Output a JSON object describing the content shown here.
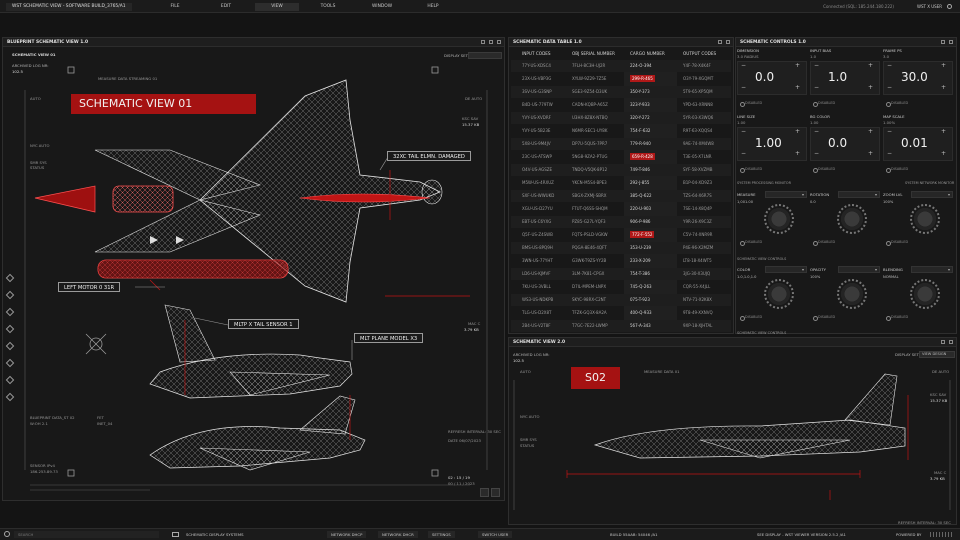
{
  "app": {
    "title": "WST SCHEMATIC VIEW - SOFTWARE BUILD_3765/A1",
    "menu": [
      "FILE",
      "EDIT",
      "VIEW",
      "TOOLS",
      "WINDOW",
      "HELP"
    ],
    "connection": "Connected (SQL: 185.244.180.222)",
    "user": "WST X USER"
  },
  "blueprint": {
    "panel_title": "BLUEPRINT SCHEMATIC VIEW 1.0",
    "subtitle": "SCHEMATIC VIEW 01",
    "archived_label": "ARCHIVED LOG NR:",
    "archived_value": "102.5",
    "display_set": "DISPLAY SET",
    "streaming": "MEASURE DATA STREAMING 01",
    "auto_left": "AUTO",
    "auto_right": "DE AUTO",
    "nyc_auto": "NYC AUTO",
    "smr": "SMR SYS",
    "status": "STATUS",
    "ksc_label": "KSC SAV",
    "ksc_value": "15.37 KB",
    "mac_label": "MAC C",
    "mac_value": "3.79 KB",
    "blueprint_label": "BLUEPRINT DATA_ST 02",
    "blueprint_value": "W:OH 2.1",
    "sensor": "SENSOR IPv4",
    "sensor_ip": "186.253.89.73",
    "fet": "FET",
    "fet_value": "INET_04",
    "refresh": "REFRESH INTERVAL: 30 SEC",
    "date": "DATE 06/07/2023",
    "time": "02 : 15 / 19",
    "time_sub": "00 / 11 / 2023",
    "red_title": "SCHEMATIC VIEW 01",
    "callouts": [
      "32XC TAIL ELMN. DAMAGED",
      "LEFT MOTOR 0 31R",
      "MLTP X TAIL SENSOR 1",
      "MLT PLANE MODEL X3"
    ]
  },
  "table": {
    "panel_title": "SCHEMATIC DATA TABLE 1.0",
    "headers": [
      "INPUT CODES",
      "OBJ SERIAL NUMBER",
      "CARGO NUMBER",
      "OUTPUT CODES"
    ],
    "rows": [
      [
        "77Y-US-XDSC4",
        "7FLH-8C3H-UJ2R",
        "224-O-394",
        "Y4F-78-X4K4F"
      ],
      [
        "23X-US-VBP3G",
        "XYLW-9Z29-7Z5E",
        "299-R-465",
        "O3Y-79-XGQMT"
      ],
      [
        "3SV-US-G3SNP",
        "SGE3-9Z54-D3UK",
        "350-Y-373",
        "5T9-65-XP5QM"
      ],
      [
        "B4D-US-779TW",
        "CADN-KQBP-A65Z",
        "323-Y-933",
        "YPD-63-XRNN8"
      ],
      [
        "YVY-US-XVDRF",
        "U3HX-8Z8X-NTBQ",
        "320-Y-272",
        "5YR-03-X3WQ6"
      ],
      [
        "YVY-US-5B23E",
        "N6MR-SEC1-UY8K",
        "754-F-632",
        "R9T-63-XQQS4"
      ],
      [
        "5X8-US-9M4JV",
        "DP7U-5QUS-7PR7",
        "779-R-940",
        "9AE-74-XM4W8"
      ],
      [
        "23C-US-ATSWP",
        "5NG8-9ZA2-PTUG",
        "659-R-428",
        "T3E-05-X7LNR"
      ],
      [
        "O4V-US-AGSZE",
        "TNDQ-V5QK-8P12",
        "749-T-846",
        "SYF-58-XVZMB"
      ],
      [
        "M5W-US-4RXUZ",
        "YKCN-M5S4-BPE3",
        "292-J-855",
        "B1P-04-XD9Z3"
      ],
      [
        "SXF-US-WWUKD",
        "SBGX-ZXMJ-SBRX",
        "385-Q-622",
        "TZS-64-X6R7S"
      ],
      [
        "XGU-US-D27YU",
        "FTUT-Q6SS-SHQM",
        "220-U-903",
        "7SE-14-X8Q4P"
      ],
      [
        "EBT-US-C6YXG",
        "PZ85-G27L-YQF3",
        "906-P-986",
        "Y9R-26-X9C3Z"
      ],
      [
        "Q5F-US-Z4SWB",
        "FQTS-PSLD-VGKW",
        "772-F-552",
        "C5V-74-XNR9R"
      ],
      [
        "BMS-US-8PQ9H",
        "PQGA-8E46-4QFT",
        "353-U-239",
        "P4E-96-X2MZM"
      ],
      [
        "3WN-US-77YHT",
        "G3WK-T9ZS-YY2B",
        "233-X-209",
        "LT8-18-X4WT5"
      ],
      [
        "LD6-US-KJMVF",
        "3LM-7K81-CPGX",
        "754-T-386",
        "3JG-30-X3UJQ"
      ],
      [
        "7KU-US-3VBLL",
        "D7IL-MPEM-LNPX",
        "745-Q-263",
        "CQR-55-X4JLL"
      ],
      [
        "WS3-US-NDKPB",
        "SKYC-98RX-C2NT",
        "075-T-923",
        "NTV-71-X2K8X"
      ],
      [
        "TLG-US-D2X8T",
        "TFZK-GQ3X-8A2A",
        "400-Q-933",
        "9T8-49-XXNVQ"
      ],
      [
        "2B4-US-V2T8F",
        "T7GC-7E22-LWMP",
        "567-A-343",
        "9XP-18-XJHTAL"
      ]
    ],
    "highlighted": [
      1,
      7,
      13
    ]
  },
  "controls": {
    "panel_title": "SCHEMATIC CONTROLS 1.0",
    "row1": [
      {
        "label": "DIMENSION",
        "sub": "3.0 RADIUS",
        "value": "0.0"
      },
      {
        "label": "INPUT BIAS",
        "sub": "1.0",
        "value": "1.0"
      },
      {
        "label": "FRAME PS",
        "sub": "3.0",
        "value": "30.0"
      }
    ],
    "row2": [
      {
        "label": "LINE SIZE",
        "sub": "1.00",
        "value": "1.00"
      },
      {
        "label": "BG COLOR",
        "sub": "1.00",
        "value": "0.0"
      },
      {
        "label": "MAP SCALE",
        "sub": "1.00%",
        "value": "0.01"
      }
    ],
    "disabled": "DISABLED",
    "monitor_left": "SYSTEM PROCESSING MONITOR",
    "monitor_right": "SYSTEM NETWORK MONITOR",
    "knobs1": [
      {
        "label": "MEASURE",
        "value": "1,001.00"
      },
      {
        "label": "ROTATION",
        "value": "0.0"
      },
      {
        "label": "ZOOM LVL",
        "value": "100%"
      }
    ],
    "section2": "SCHEMATIC VIEW CONTROLS",
    "knobs2": [
      {
        "label": "COLOR",
        "value": "1.0,1.0,1.0"
      },
      {
        "label": "OPACITY",
        "value": "100%"
      },
      {
        "label": "BLENDING",
        "value": "NORMAL"
      }
    ],
    "section3": "SCHEMATIC VIEW CONTROLS"
  },
  "schematic2": {
    "panel_title": "SCHEMATIC VIEW 2.0",
    "archived_label": "ARCHIVED LOG NR:",
    "archived_value": "102.5",
    "display_set": "DISPLAY SET",
    "display_btn": "VIEW DESIGN",
    "red_tag": "S02",
    "streaming": "MEASURE DATA 01",
    "auto_left": "AUTO",
    "auto_right": "DE AUTO",
    "nyc_auto": "NYC AUTO",
    "smr": "SMR SYS",
    "status": "STATUS",
    "ksc_label": "KSC SAV",
    "ksc_value": "15.37 KB",
    "mac_label": "MAC C",
    "mac_value": "3.79 KB",
    "refresh": "REFRESH INTERVAL: 30 SEC"
  },
  "bottom": {
    "search": "SEARCH",
    "system": "SCHEMATIC DISPLAY SYSTEMS",
    "buttons": [
      "NETWORK DHCP",
      "NETWORK DHCR",
      "SETTINGS",
      "SWITCH USER"
    ],
    "build": "BUILD 55AAB: 54046 /A1",
    "version": "SEE DISPLAY - WST VIEWER VERSION 2.5.2 /A1",
    "powered": "POWERED BY"
  },
  "colors": {
    "accent": "#b01818",
    "panel": "#181818",
    "background": "#141414"
  }
}
